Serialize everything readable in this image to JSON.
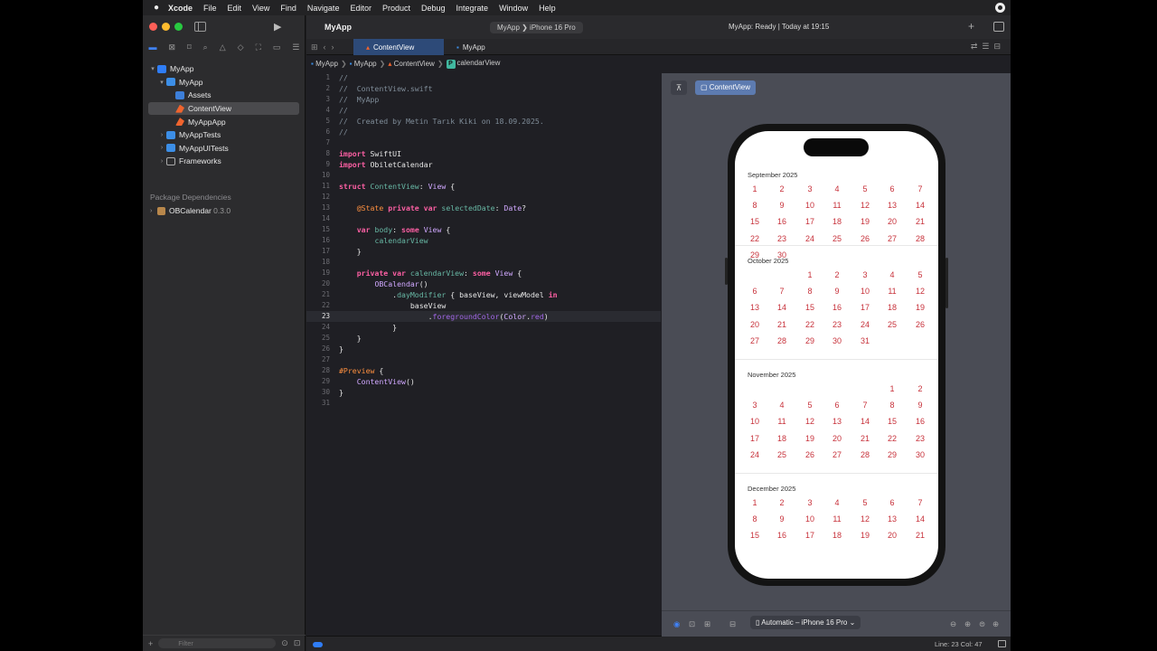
{
  "menubar": {
    "app": "Xcode",
    "items": [
      "File",
      "Edit",
      "View",
      "Find",
      "Navigate",
      "Editor",
      "Product",
      "Debug",
      "Integrate",
      "Window",
      "Help"
    ]
  },
  "toolbar": {
    "project_title": "MyApp",
    "scheme": "MyApp ❯ iPhone 16 Pro",
    "status": "MyApp: Ready | Today at 19:15"
  },
  "navigator": {
    "items": [
      {
        "label": "MyApp",
        "icon": "project",
        "level": 0,
        "disclosure": "▾"
      },
      {
        "label": "MyApp",
        "icon": "folder",
        "level": 1,
        "disclosure": "▾"
      },
      {
        "label": "Assets",
        "icon": "assets",
        "level": 2,
        "disclosure": ""
      },
      {
        "label": "ContentView",
        "icon": "swift",
        "level": 2,
        "disclosure": "",
        "selected": true
      },
      {
        "label": "MyAppApp",
        "icon": "swift",
        "level": 2,
        "disclosure": ""
      },
      {
        "label": "MyAppTests",
        "icon": "folder",
        "level": 1,
        "disclosure": "›"
      },
      {
        "label": "MyAppUITests",
        "icon": "folder",
        "level": 1,
        "disclosure": "›"
      },
      {
        "label": "Frameworks",
        "icon": "none",
        "level": 1,
        "disclosure": "›"
      }
    ],
    "package_header": "Package Dependencies",
    "package": {
      "name": "OBCalendar",
      "version": "0.3.0"
    },
    "filter_placeholder": "Filter"
  },
  "tabs": [
    {
      "label": "ContentView",
      "active": true
    },
    {
      "label": "MyApp",
      "active": false
    }
  ],
  "jumpbar": [
    "MyApp",
    "MyApp",
    "ContentView",
    "calendarView"
  ],
  "code": [
    "<span class=\"cm\">//</span>",
    "<span class=\"cm\">//  ContentView.swift</span>",
    "<span class=\"cm\">//  MyApp</span>",
    "<span class=\"cm\">//</span>",
    "<span class=\"cm\">//  Created by Metin Tarık Kiki on 18.09.2025.</span>",
    "<span class=\"cm\">//</span>",
    "",
    "<span class=\"kw\">import</span> SwiftUI",
    "<span class=\"kw\">import</span> ObiletCalendar",
    "",
    "<span class=\"kw\">struct</span> <span class=\"id\">ContentView</span>: <span class=\"ty\">View</span> {",
    "",
    "    <span class=\"ma\">@State</span> <span class=\"kw\">private var</span> <span class=\"id\">selectedDate</span>: <span class=\"ty\">Date</span>?",
    "",
    "    <span class=\"kw\">var</span> <span class=\"id\">body</span>: <span class=\"kw\">some</span> <span class=\"ty\">View</span> {",
    "        <span class=\"id\">calendarView</span>",
    "    }",
    "",
    "    <span class=\"kw\">private var</span> <span class=\"id\">calendarView</span>: <span class=\"kw\">some</span> <span class=\"ty\">View</span> {",
    "        <span class=\"ty\">OBCalendar</span>()",
    "            .<span class=\"id\">dayModifier</span> { baseView, viewModel <span class=\"kw\">in</span>",
    "                baseView",
    "                    .<span class=\"fn\">foregroundColor</span>(<span class=\"ty\">Color</span>.<span class=\"fn\">red</span>)",
    "            }",
    "    }",
    "}",
    "",
    "<span class=\"ma\">#Preview</span> {",
    "    <span class=\"ty\">ContentView</span>()",
    "}",
    ""
  ],
  "current_line": 23,
  "preview": {
    "chip_label": "ContentView",
    "device_menu": "Automatic – iPhone 16 Pro",
    "months": [
      {
        "title": "September 2025",
        "offset": 0,
        "days": 30,
        "visible_days": 30
      },
      {
        "title": "October 2025",
        "offset": 2,
        "days": 31,
        "visible_days": 31
      },
      {
        "title": "November 2025",
        "offset": 5,
        "days": 30,
        "visible_days": 30
      },
      {
        "title": "December 2025",
        "offset": 0,
        "days": 31,
        "visible_days": 21
      }
    ],
    "day_color": "#c7313a"
  },
  "status_bar": {
    "position": "Line: 23  Col: 47"
  }
}
